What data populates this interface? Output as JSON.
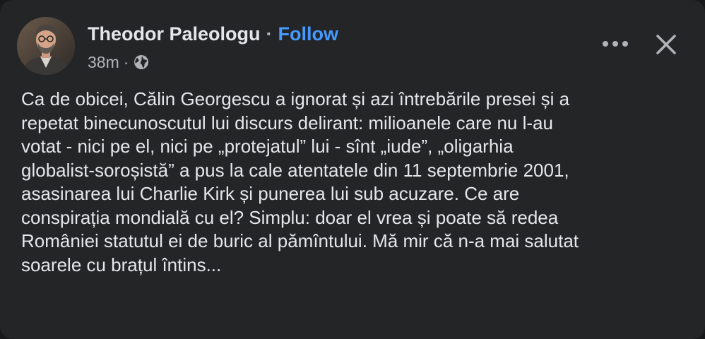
{
  "post": {
    "author": "Theodor Paleologu",
    "separator": "·",
    "follow_label": "Follow",
    "timestamp": "38m",
    "meta_separator": "·",
    "privacy_icon": "globe-icon",
    "lines": [
      "Ca de obicei, Călin Georgescu a ignorat și azi întrebările presei și a",
      "repetat binecunoscutul lui discurs delirant: milioanele care nu l-au",
      "votat - nici pe el, nici pe „protejatul” lui - sînt „iude”, „oligarhia",
      "globalist-soroșistă” a pus la cale atentatele din 11 septembrie 2001,",
      "asasinarea lui Charlie Kirk și punerea lui sub acuzare. Ce are",
      "conspirația mondială cu el? Simplu: doar el vrea și poate să redea",
      "României statutul ei de buric al pămîntului. Mă mir că n-a mai salutat",
      "soarele cu brațul întins..."
    ]
  },
  "actions": {
    "more_icon": "more-options-icon",
    "close_icon": "close-icon"
  },
  "colors": {
    "background": "#242526",
    "text": "#e4e6eb",
    "secondary_text": "#b0b3b8",
    "link": "#4599ff"
  }
}
